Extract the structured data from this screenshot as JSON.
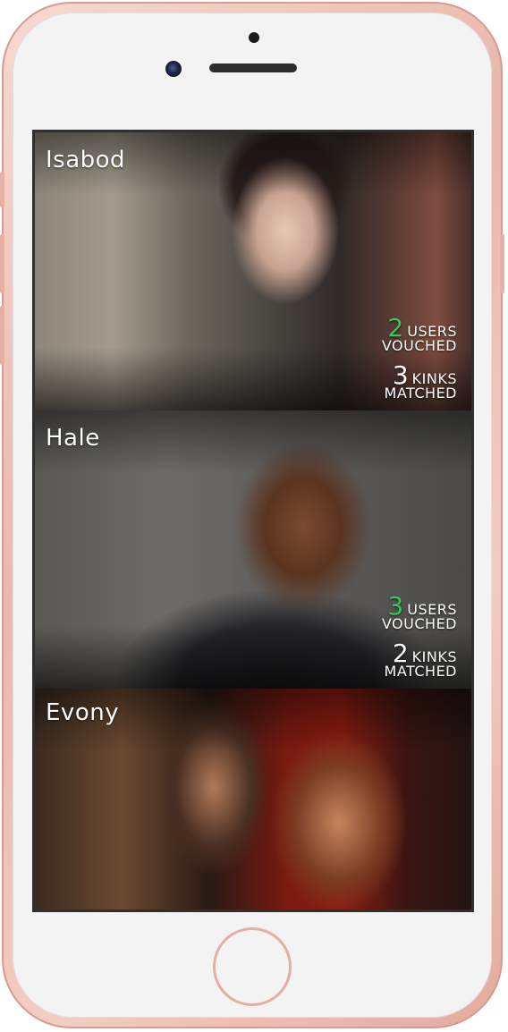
{
  "colors": {
    "accent_green": "#35c759",
    "phone_rose_gold": "#e9b7ab",
    "screen_bg": "#2e2e2e",
    "text": "#ffffff"
  },
  "profiles": [
    {
      "name": "Isabod",
      "users_count": "2",
      "users_word": "USERS",
      "users_caption": "VOUCHED",
      "users_count_color": "green",
      "kinks_count": "3",
      "kinks_word": "KINKS",
      "kinks_caption": "MATCHED"
    },
    {
      "name": "Hale",
      "users_count": "3",
      "users_word": "USERS",
      "users_caption": "VOUCHED",
      "users_count_color": "green",
      "kinks_count": "2",
      "kinks_word": "KINKS",
      "kinks_caption": "MATCHED"
    },
    {
      "name": "Evony"
    }
  ],
  "icons": [
    "front-camera-icon",
    "speaker-grille-icon",
    "home-button-icon"
  ]
}
